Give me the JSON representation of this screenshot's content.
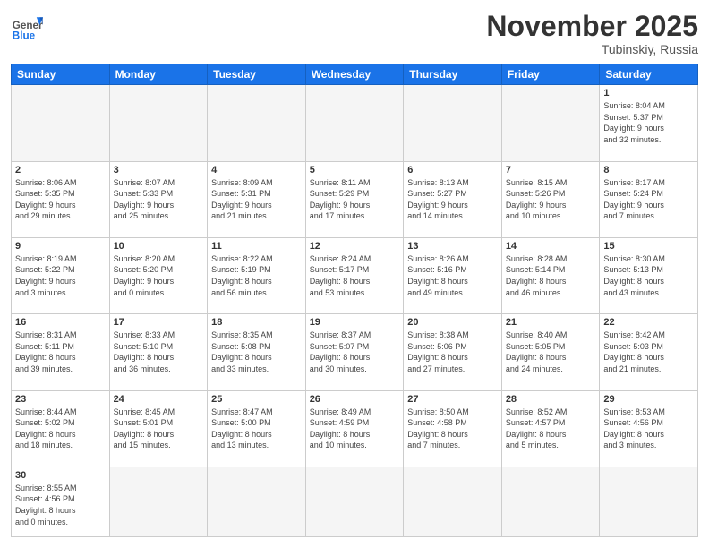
{
  "header": {
    "logo_general": "General",
    "logo_blue": "Blue",
    "month": "November 2025",
    "location": "Tubinskiy, Russia"
  },
  "days_of_week": [
    "Sunday",
    "Monday",
    "Tuesday",
    "Wednesday",
    "Thursday",
    "Friday",
    "Saturday"
  ],
  "weeks": [
    [
      {
        "day": "",
        "info": ""
      },
      {
        "day": "",
        "info": ""
      },
      {
        "day": "",
        "info": ""
      },
      {
        "day": "",
        "info": ""
      },
      {
        "day": "",
        "info": ""
      },
      {
        "day": "",
        "info": ""
      },
      {
        "day": "1",
        "info": "Sunrise: 8:04 AM\nSunset: 5:37 PM\nDaylight: 9 hours\nand 32 minutes."
      }
    ],
    [
      {
        "day": "2",
        "info": "Sunrise: 8:06 AM\nSunset: 5:35 PM\nDaylight: 9 hours\nand 29 minutes."
      },
      {
        "day": "3",
        "info": "Sunrise: 8:07 AM\nSunset: 5:33 PM\nDaylight: 9 hours\nand 25 minutes."
      },
      {
        "day": "4",
        "info": "Sunrise: 8:09 AM\nSunset: 5:31 PM\nDaylight: 9 hours\nand 21 minutes."
      },
      {
        "day": "5",
        "info": "Sunrise: 8:11 AM\nSunset: 5:29 PM\nDaylight: 9 hours\nand 17 minutes."
      },
      {
        "day": "6",
        "info": "Sunrise: 8:13 AM\nSunset: 5:27 PM\nDaylight: 9 hours\nand 14 minutes."
      },
      {
        "day": "7",
        "info": "Sunrise: 8:15 AM\nSunset: 5:26 PM\nDaylight: 9 hours\nand 10 minutes."
      },
      {
        "day": "8",
        "info": "Sunrise: 8:17 AM\nSunset: 5:24 PM\nDaylight: 9 hours\nand 7 minutes."
      }
    ],
    [
      {
        "day": "9",
        "info": "Sunrise: 8:19 AM\nSunset: 5:22 PM\nDaylight: 9 hours\nand 3 minutes."
      },
      {
        "day": "10",
        "info": "Sunrise: 8:20 AM\nSunset: 5:20 PM\nDaylight: 9 hours\nand 0 minutes."
      },
      {
        "day": "11",
        "info": "Sunrise: 8:22 AM\nSunset: 5:19 PM\nDaylight: 8 hours\nand 56 minutes."
      },
      {
        "day": "12",
        "info": "Sunrise: 8:24 AM\nSunset: 5:17 PM\nDaylight: 8 hours\nand 53 minutes."
      },
      {
        "day": "13",
        "info": "Sunrise: 8:26 AM\nSunset: 5:16 PM\nDaylight: 8 hours\nand 49 minutes."
      },
      {
        "day": "14",
        "info": "Sunrise: 8:28 AM\nSunset: 5:14 PM\nDaylight: 8 hours\nand 46 minutes."
      },
      {
        "day": "15",
        "info": "Sunrise: 8:30 AM\nSunset: 5:13 PM\nDaylight: 8 hours\nand 43 minutes."
      }
    ],
    [
      {
        "day": "16",
        "info": "Sunrise: 8:31 AM\nSunset: 5:11 PM\nDaylight: 8 hours\nand 39 minutes."
      },
      {
        "day": "17",
        "info": "Sunrise: 8:33 AM\nSunset: 5:10 PM\nDaylight: 8 hours\nand 36 minutes."
      },
      {
        "day": "18",
        "info": "Sunrise: 8:35 AM\nSunset: 5:08 PM\nDaylight: 8 hours\nand 33 minutes."
      },
      {
        "day": "19",
        "info": "Sunrise: 8:37 AM\nSunset: 5:07 PM\nDaylight: 8 hours\nand 30 minutes."
      },
      {
        "day": "20",
        "info": "Sunrise: 8:38 AM\nSunset: 5:06 PM\nDaylight: 8 hours\nand 27 minutes."
      },
      {
        "day": "21",
        "info": "Sunrise: 8:40 AM\nSunset: 5:05 PM\nDaylight: 8 hours\nand 24 minutes."
      },
      {
        "day": "22",
        "info": "Sunrise: 8:42 AM\nSunset: 5:03 PM\nDaylight: 8 hours\nand 21 minutes."
      }
    ],
    [
      {
        "day": "23",
        "info": "Sunrise: 8:44 AM\nSunset: 5:02 PM\nDaylight: 8 hours\nand 18 minutes."
      },
      {
        "day": "24",
        "info": "Sunrise: 8:45 AM\nSunset: 5:01 PM\nDaylight: 8 hours\nand 15 minutes."
      },
      {
        "day": "25",
        "info": "Sunrise: 8:47 AM\nSunset: 5:00 PM\nDaylight: 8 hours\nand 13 minutes."
      },
      {
        "day": "26",
        "info": "Sunrise: 8:49 AM\nSunset: 4:59 PM\nDaylight: 8 hours\nand 10 minutes."
      },
      {
        "day": "27",
        "info": "Sunrise: 8:50 AM\nSunset: 4:58 PM\nDaylight: 8 hours\nand 7 minutes."
      },
      {
        "day": "28",
        "info": "Sunrise: 8:52 AM\nSunset: 4:57 PM\nDaylight: 8 hours\nand 5 minutes."
      },
      {
        "day": "29",
        "info": "Sunrise: 8:53 AM\nSunset: 4:56 PM\nDaylight: 8 hours\nand 3 minutes."
      }
    ],
    [
      {
        "day": "30",
        "info": "Sunrise: 8:55 AM\nSunset: 4:56 PM\nDaylight: 8 hours\nand 0 minutes."
      },
      {
        "day": "",
        "info": ""
      },
      {
        "day": "",
        "info": ""
      },
      {
        "day": "",
        "info": ""
      },
      {
        "day": "",
        "info": ""
      },
      {
        "day": "",
        "info": ""
      },
      {
        "day": "",
        "info": ""
      }
    ]
  ]
}
